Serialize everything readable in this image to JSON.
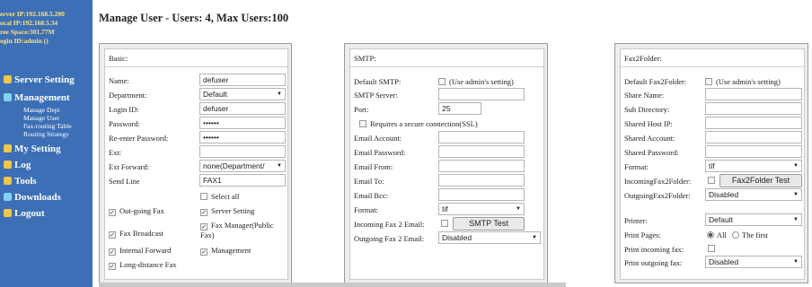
{
  "sidebar": {
    "info": {
      "server_ip": "erver IP:192.168.5.200",
      "local_ip": "ocal IP:192.168.5.34",
      "free_space": "ree Space:301.77M",
      "login_id": "ogin ID:admin ()"
    },
    "nav": {
      "server_setting": "Server Setting",
      "management": "Management",
      "sub": [
        "Manage Dept",
        "Manage User",
        "Fax-routing Table",
        "Routing Strategy"
      ],
      "my_setting": "My Setting",
      "log": "Log",
      "tools": "Tools",
      "downloads": "Downloads",
      "logout": "Logout"
    },
    "colors": {
      "background": "#3c6fb6",
      "info_text": "#ffe27a",
      "icon": "#f2c744"
    }
  },
  "page": {
    "title": "Manage User - Users: 4, Max Users:100"
  },
  "basic": {
    "header": "Basic:",
    "name_label": "Name:",
    "name_value": "defuser",
    "department_label": "Department:",
    "department_value": "Default",
    "login_id_label": "Login ID:",
    "login_id_value": "defuser",
    "password_label": "Password:",
    "password_value": "••••••",
    "reenter_label": "Re-enter Password:",
    "reenter_value": "••••••",
    "ext_label": "Ext:",
    "ext_value": "",
    "ext_forward_label": "Ext Forward:",
    "ext_forward_value": "none(Department/",
    "send_line_label": "Send Line",
    "send_line_value": "FAX1",
    "select_all": "Select all",
    "perms": {
      "outgoing_fax": "Out-going Fax",
      "server_setting": "Server Setting",
      "fax_broadcast": "Fax Broadcast",
      "fax_manager": "Fax Manager(Public Fax)",
      "internal_forward": "Internal Forward",
      "management": "Management",
      "long_distance": "Long-distance Fax"
    }
  },
  "smtp": {
    "header": "SMTP:",
    "default_smtp_label": "Default SMTP:",
    "use_admin": "(Use admin's setting)",
    "server_label": "SMTP Server:",
    "server_value": "",
    "port_label": "Port:",
    "port_value": "25",
    "ssl_label": "Requires a secure connection(SSL)",
    "account_label": "Email Account:",
    "password_label": "Email Password:",
    "from_label": "Email From:",
    "to_label": "Email To:",
    "bcc_label": "Email Bcc:",
    "format_label": "Format:",
    "format_value": "tif",
    "incoming_label": "Incoming Fax 2 Email:",
    "test_button": "SMTP Test",
    "outgoing_label": "Outgoing Fax 2 Email:",
    "outgoing_value": "Disabled"
  },
  "fax2folder": {
    "header": "Fax2Folder:",
    "default_label": "Default Fax2Folder:",
    "use_admin": "(Use admin's setting)",
    "share_name_label": "Share Name:",
    "sub_dir_label": "Sub Directory:",
    "host_ip_label": "Shared Host IP:",
    "account_label": "Shared Account:",
    "password_label": "Shared Password:",
    "format_label": "Format:",
    "format_value": "tif",
    "incoming_label": "IncomingFax2Folder:",
    "test_button": "Fax2Folder Test",
    "outgoing_label": "OutgoingFax2Folder:",
    "outgoing_value": "Disabled",
    "printer_label": "Printer:",
    "printer_value": "Default",
    "print_pages_label": "Print Pages:",
    "all_label": "All",
    "first_label": "The first",
    "print_incoming_label": "Print incoming fax:",
    "print_outgoing_label": "Print outgoing fax:",
    "print_outgoing_value": "Disabled"
  }
}
